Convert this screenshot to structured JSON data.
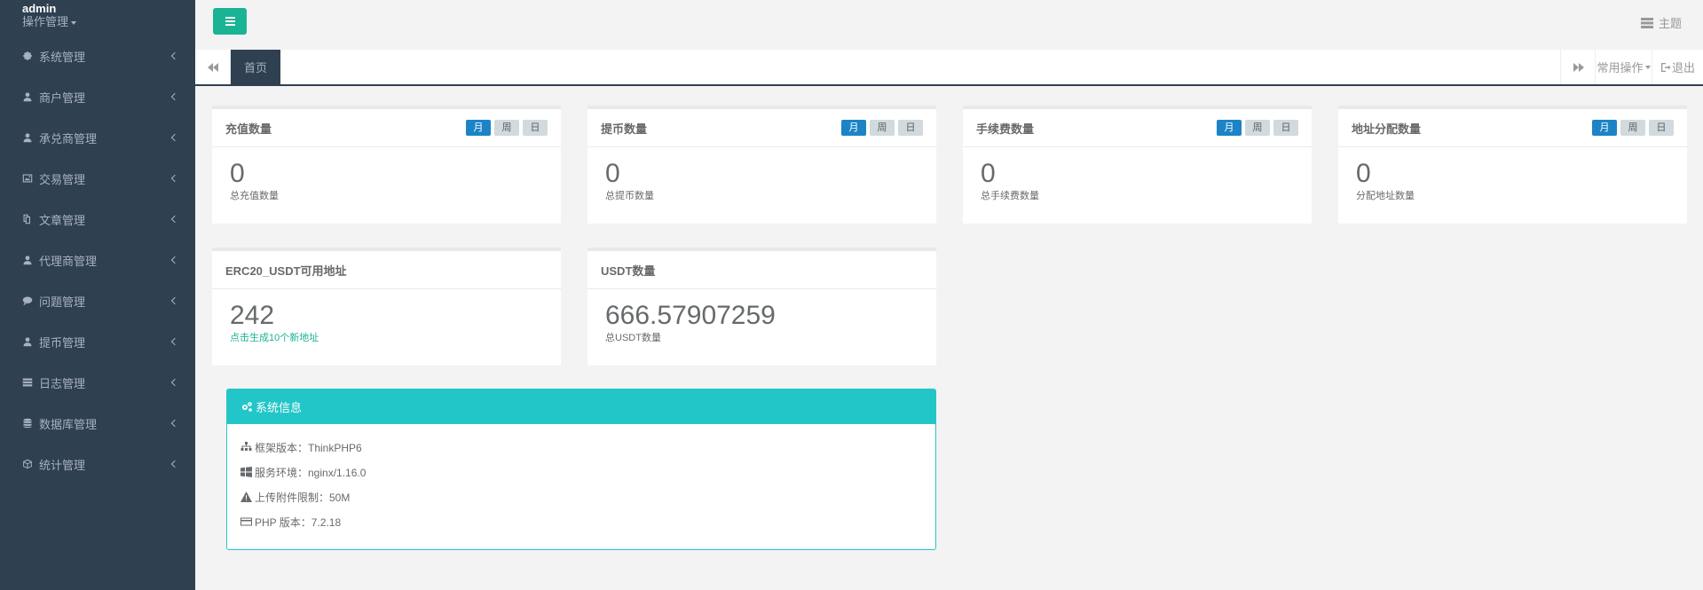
{
  "sidebar": {
    "user_name": "admin",
    "role": "操作管理",
    "items": [
      {
        "label": "系统管理",
        "icon": "gear-icon"
      },
      {
        "label": "商户管理",
        "icon": "user-icon"
      },
      {
        "label": "承兑商管理",
        "icon": "user-icon"
      },
      {
        "label": "交易管理",
        "icon": "image-icon"
      },
      {
        "label": "文章管理",
        "icon": "copy-icon"
      },
      {
        "label": "代理商管理",
        "icon": "user-icon"
      },
      {
        "label": "问题管理",
        "icon": "comment-icon"
      },
      {
        "label": "提币管理",
        "icon": "user-icon"
      },
      {
        "label": "日志管理",
        "icon": "list-icon"
      },
      {
        "label": "数据库管理",
        "icon": "database-icon"
      },
      {
        "label": "统计管理",
        "icon": "cube-icon"
      }
    ]
  },
  "topbar": {
    "theme_label": "主题"
  },
  "tabs": {
    "active": "首页",
    "common_ops": "常用操作",
    "logout": "退出"
  },
  "stats": [
    {
      "title": "充值数量",
      "value": "0",
      "desc": "总充值数量",
      "periods": [
        "月",
        "周",
        "日"
      ]
    },
    {
      "title": "提币数量",
      "value": "0",
      "desc": "总提币数量",
      "periods": [
        "月",
        "周",
        "日"
      ]
    },
    {
      "title": "手续费数量",
      "value": "0",
      "desc": "总手续费数量",
      "periods": [
        "月",
        "周",
        "日"
      ]
    },
    {
      "title": "地址分配数量",
      "value": "0",
      "desc": "分配地址数量",
      "periods": [
        "月",
        "周",
        "日"
      ]
    }
  ],
  "erc20": {
    "title": "ERC20_USDT可用地址",
    "value": "242",
    "link": "点击生成10个新地址"
  },
  "usdt": {
    "title": "USDT数量",
    "value": "666.57907259",
    "desc": "总USDT数量"
  },
  "sysinfo": {
    "title": "系统信息",
    "rows": [
      "框架版本：ThinkPHP6",
      "服务环境：nginx/1.16.0",
      "上传附件限制：50M",
      "PHP 版本：7.2.18"
    ]
  },
  "colors": {
    "sidebar": "#2f4050",
    "primary": "#1ab394",
    "info": "#23c6c8",
    "active_period": "#1c84c6"
  }
}
